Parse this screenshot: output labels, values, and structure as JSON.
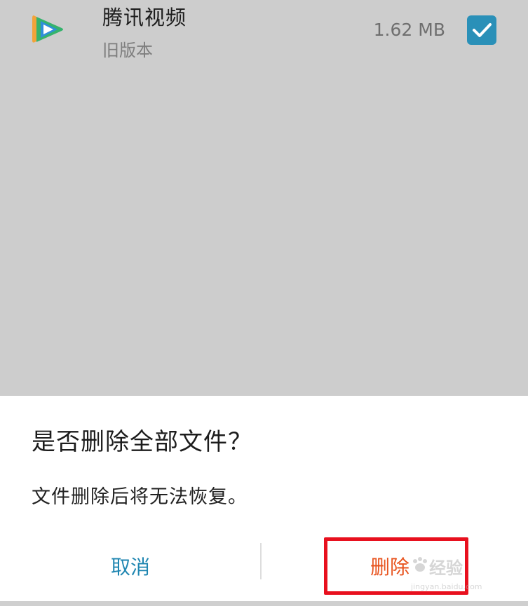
{
  "app": {
    "name": "腾讯视频",
    "subtitle": "旧版本",
    "size": "1.62 MB",
    "checked": true,
    "icon": "tencent-video-icon"
  },
  "dialog": {
    "title": "是否删除全部文件？",
    "message": "文件删除后将无法恢复。",
    "cancel_label": "取消",
    "delete_label": "删除"
  },
  "watermark": {
    "text": "经验",
    "url": "jingyan.baidu.com"
  },
  "colors": {
    "accent_blue": "#2a90b8",
    "delete_orange": "#e8541f",
    "highlight_red": "#e8101e",
    "overlay_gray": "#cdcdcd"
  }
}
